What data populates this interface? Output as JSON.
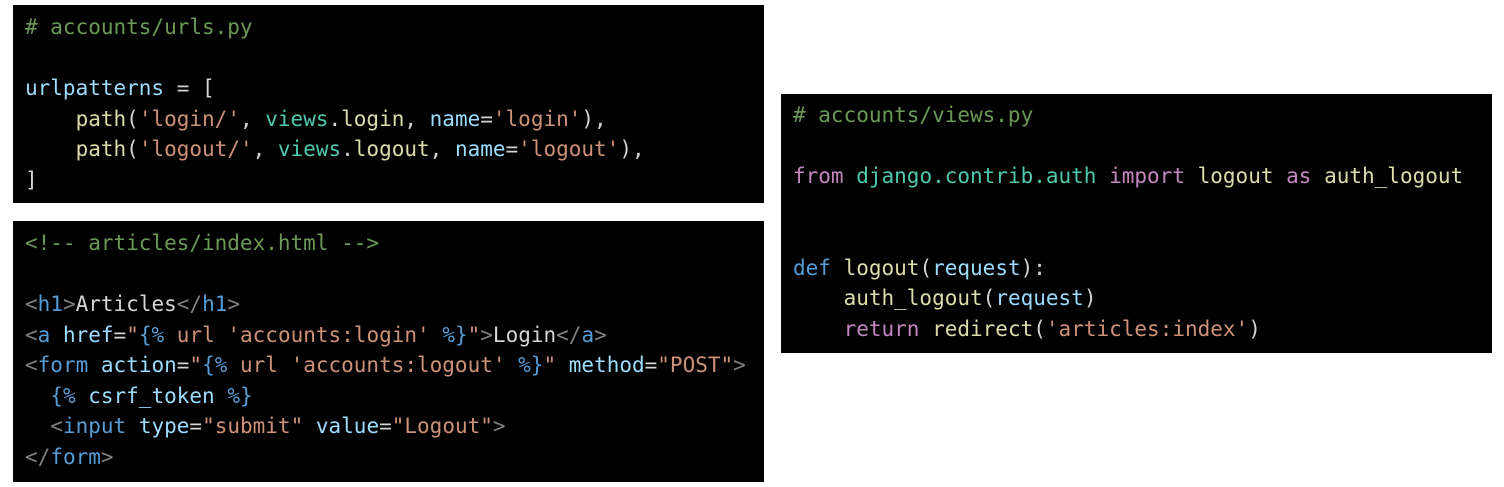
{
  "colors": {
    "background": "#ffffff",
    "code_background": "#000000",
    "comment": "#6a9955",
    "variable": "#9cdcfe",
    "function": "#dcdcaa",
    "string": "#ce9178",
    "module": "#4ec9b0",
    "keyword": "#c586c0",
    "def_keyword": "#569cd6",
    "html_tag": "#569cd6",
    "punctuation": "#808080",
    "default_text": "#d4d4d4"
  },
  "blocks": [
    {
      "id": "urls",
      "lines": [
        [
          {
            "t": "comment",
            "v": "# accounts/urls.py"
          }
        ],
        [],
        [
          {
            "t": "var",
            "v": "urlpatterns"
          },
          {
            "t": "text",
            "v": " = ["
          }
        ],
        [
          {
            "t": "text",
            "v": "    "
          },
          {
            "t": "func",
            "v": "path"
          },
          {
            "t": "text",
            "v": "("
          },
          {
            "t": "string",
            "v": "'login/'"
          },
          {
            "t": "text",
            "v": ", "
          },
          {
            "t": "module",
            "v": "views"
          },
          {
            "t": "text",
            "v": "."
          },
          {
            "t": "func",
            "v": "login"
          },
          {
            "t": "text",
            "v": ", "
          },
          {
            "t": "var",
            "v": "name"
          },
          {
            "t": "text",
            "v": "="
          },
          {
            "t": "string",
            "v": "'login'"
          },
          {
            "t": "text",
            "v": "),"
          }
        ],
        [
          {
            "t": "text",
            "v": "    "
          },
          {
            "t": "func",
            "v": "path"
          },
          {
            "t": "text",
            "v": "("
          },
          {
            "t": "string",
            "v": "'logout/'"
          },
          {
            "t": "text",
            "v": ", "
          },
          {
            "t": "module",
            "v": "views"
          },
          {
            "t": "text",
            "v": "."
          },
          {
            "t": "func",
            "v": "logout"
          },
          {
            "t": "text",
            "v": ", "
          },
          {
            "t": "var",
            "v": "name"
          },
          {
            "t": "text",
            "v": "="
          },
          {
            "t": "string",
            "v": "'logout'"
          },
          {
            "t": "text",
            "v": "),"
          }
        ],
        [
          {
            "t": "text",
            "v": "]"
          }
        ]
      ]
    },
    {
      "id": "index",
      "lines": [
        [
          {
            "t": "comment",
            "v": "<!-- articles/index.html -->"
          }
        ],
        [],
        [
          {
            "t": "punct",
            "v": "<"
          },
          {
            "t": "tag",
            "v": "h1"
          },
          {
            "t": "punct",
            "v": ">"
          },
          {
            "t": "text",
            "v": "Articles"
          },
          {
            "t": "punct",
            "v": "</"
          },
          {
            "t": "tag",
            "v": "h1"
          },
          {
            "t": "punct",
            "v": ">"
          }
        ],
        [
          {
            "t": "punct",
            "v": "<"
          },
          {
            "t": "tag",
            "v": "a"
          },
          {
            "t": "text",
            "v": " "
          },
          {
            "t": "attr",
            "v": "href"
          },
          {
            "t": "text",
            "v": "="
          },
          {
            "t": "string",
            "v": "\""
          },
          {
            "t": "template",
            "v": "{%"
          },
          {
            "t": "string",
            "v": " url 'accounts:login' "
          },
          {
            "t": "template",
            "v": "%}"
          },
          {
            "t": "string",
            "v": "\""
          },
          {
            "t": "punct",
            "v": ">"
          },
          {
            "t": "text",
            "v": "Login"
          },
          {
            "t": "punct",
            "v": "</"
          },
          {
            "t": "tag",
            "v": "a"
          },
          {
            "t": "punct",
            "v": ">"
          }
        ],
        [
          {
            "t": "punct",
            "v": "<"
          },
          {
            "t": "tag",
            "v": "form"
          },
          {
            "t": "text",
            "v": " "
          },
          {
            "t": "attr",
            "v": "action"
          },
          {
            "t": "text",
            "v": "="
          },
          {
            "t": "string",
            "v": "\""
          },
          {
            "t": "template",
            "v": "{%"
          },
          {
            "t": "string",
            "v": " url 'accounts:logout' "
          },
          {
            "t": "template",
            "v": "%}"
          },
          {
            "t": "string",
            "v": "\""
          },
          {
            "t": "text",
            "v": " "
          },
          {
            "t": "attr",
            "v": "method"
          },
          {
            "t": "text",
            "v": "="
          },
          {
            "t": "string",
            "v": "\"POST\""
          },
          {
            "t": "punct",
            "v": ">"
          }
        ],
        [
          {
            "t": "text",
            "v": "  "
          },
          {
            "t": "template",
            "v": "{%"
          },
          {
            "t": "var",
            "v": " csrf_token "
          },
          {
            "t": "template",
            "v": "%}"
          }
        ],
        [
          {
            "t": "text",
            "v": "  "
          },
          {
            "t": "punct",
            "v": "<"
          },
          {
            "t": "tag",
            "v": "input"
          },
          {
            "t": "text",
            "v": " "
          },
          {
            "t": "attr",
            "v": "type"
          },
          {
            "t": "text",
            "v": "="
          },
          {
            "t": "string",
            "v": "\"submit\""
          },
          {
            "t": "text",
            "v": " "
          },
          {
            "t": "attr",
            "v": "value"
          },
          {
            "t": "text",
            "v": "="
          },
          {
            "t": "string",
            "v": "\"Logout\""
          },
          {
            "t": "punct",
            "v": ">"
          }
        ],
        [
          {
            "t": "punct",
            "v": "</"
          },
          {
            "t": "tag",
            "v": "form"
          },
          {
            "t": "punct",
            "v": ">"
          }
        ]
      ]
    },
    {
      "id": "views",
      "lines": [
        [
          {
            "t": "comment",
            "v": "# accounts/views.py"
          }
        ],
        [],
        [
          {
            "t": "keyword",
            "v": "from"
          },
          {
            "t": "text",
            "v": " "
          },
          {
            "t": "module",
            "v": "django.contrib.auth"
          },
          {
            "t": "text",
            "v": " "
          },
          {
            "t": "keyword",
            "v": "import"
          },
          {
            "t": "text",
            "v": " "
          },
          {
            "t": "func",
            "v": "logout"
          },
          {
            "t": "text",
            "v": " "
          },
          {
            "t": "keyword",
            "v": "as"
          },
          {
            "t": "text",
            "v": " "
          },
          {
            "t": "func",
            "v": "auth_logout"
          }
        ],
        [],
        [],
        [
          {
            "t": "def",
            "v": "def"
          },
          {
            "t": "text",
            "v": " "
          },
          {
            "t": "func",
            "v": "logout"
          },
          {
            "t": "text",
            "v": "("
          },
          {
            "t": "var",
            "v": "request"
          },
          {
            "t": "text",
            "v": "):"
          }
        ],
        [
          {
            "t": "text",
            "v": "    "
          },
          {
            "t": "func",
            "v": "auth_logout"
          },
          {
            "t": "text",
            "v": "("
          },
          {
            "t": "var",
            "v": "request"
          },
          {
            "t": "text",
            "v": ")"
          }
        ],
        [
          {
            "t": "text",
            "v": "    "
          },
          {
            "t": "keyword",
            "v": "return"
          },
          {
            "t": "text",
            "v": " "
          },
          {
            "t": "func",
            "v": "redirect"
          },
          {
            "t": "text",
            "v": "("
          },
          {
            "t": "string",
            "v": "'articles:index'"
          },
          {
            "t": "text",
            "v": ")"
          }
        ]
      ]
    }
  ]
}
